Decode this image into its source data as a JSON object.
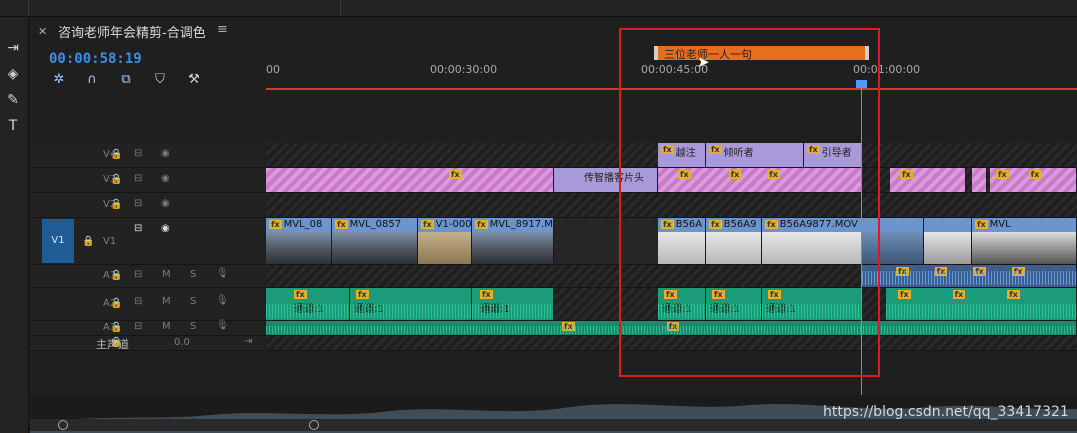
{
  "sequence": {
    "title": "咨询老师年会精剪-合调色",
    "timecode": "00:00:58:19",
    "close_icon": "close-icon",
    "menu_icon": "hamburger-icon"
  },
  "ruler": {
    "ticks": [
      "00",
      "00:00:30:00",
      "00:00:45:00",
      "00:01:00:00"
    ]
  },
  "marker": {
    "label": "三位老师一人一句"
  },
  "tracks": {
    "v4": "V4",
    "v3": "V3",
    "v2": "V2",
    "v1": "V1",
    "v1_patch": "V1",
    "a1": "A1",
    "a2": "A2",
    "a3": "A3",
    "master": "主声道",
    "master_value": "0.0"
  },
  "track_toggles": {
    "mute": "M",
    "solo": "S"
  },
  "clips": {
    "v4": [
      "越注",
      "倾听者",
      "引导者"
    ],
    "v3": [
      "传智播客片头"
    ],
    "v1": [
      "MVL_08",
      "MVL_0857",
      "V1-000",
      "MVL_8917.MC",
      "B56A",
      "B56A9",
      "B56A9877.MOV",
      "MVL"
    ],
    "a2": [
      "通道:1",
      "通道:1",
      "通道:1",
      "通道:1",
      "通道:1",
      "通道:1"
    ]
  },
  "watermark": "https://blog.csdn.net/qq_33417321",
  "colors": {
    "accent": "#3d8ee6",
    "marker": "#e86d1c",
    "highlight_box": "#e01b1b",
    "video_clip": "#6c95cf",
    "audio_clip": "#1b9b78",
    "title_clip": "#a89ad8",
    "nested_clip": "#dd99dd",
    "fx_badge": "#e3b02c"
  }
}
